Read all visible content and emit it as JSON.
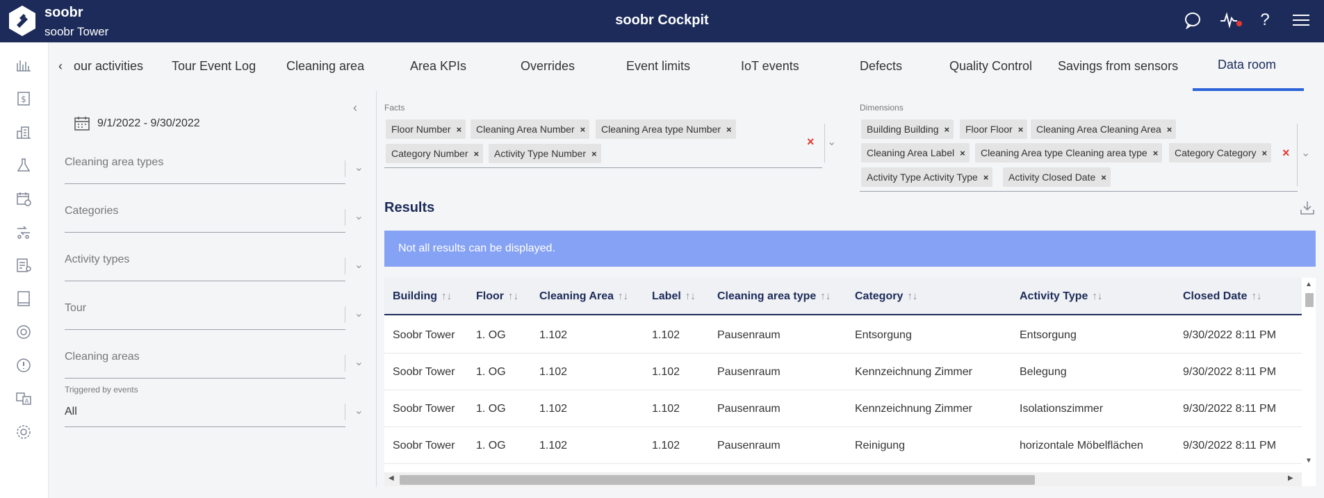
{
  "header": {
    "brand_name": "soobr",
    "building": "soobr Tower",
    "title": "soobr Cockpit"
  },
  "tabs": [
    {
      "label": "our activities"
    },
    {
      "label": "Tour Event Log"
    },
    {
      "label": "Cleaning area"
    },
    {
      "label": "Area KPIs"
    },
    {
      "label": "Overrides"
    },
    {
      "label": "Event limits"
    },
    {
      "label": "IoT events"
    },
    {
      "label": "Defects"
    },
    {
      "label": "Quality Control"
    },
    {
      "label": "Savings from sensors"
    },
    {
      "label": "Data room"
    }
  ],
  "filters": {
    "date_range": "9/1/2022 - 9/30/2022",
    "cleaning_area_types": "Cleaning area types",
    "categories": "Categories",
    "activity_types": "Activity types",
    "tour": "Tour",
    "cleaning_areas": "Cleaning areas",
    "triggered_label": "Triggered by events",
    "triggered_value": "All"
  },
  "facts": {
    "label": "Facts",
    "chips": [
      "Floor Number",
      "Cleaning Area Number",
      "Cleaning Area type Number",
      "Category Number",
      "Activity Type Number"
    ]
  },
  "dimensions": {
    "label": "Dimensions",
    "chips": [
      "Building Building",
      "Floor Floor",
      "Cleaning Area Cleaning Area",
      "Cleaning Area Label",
      "Cleaning Area type Cleaning area type",
      "Category Category",
      "Activity Type Activity Type",
      "Activity Closed Date"
    ]
  },
  "results": {
    "title": "Results",
    "banner": "Not all results can be displayed.",
    "columns": [
      "Building",
      "Floor",
      "Cleaning Area",
      "Label",
      "Cleaning area type",
      "Category",
      "Activity Type",
      "Closed Date"
    ],
    "rows": [
      [
        "Soobr Tower",
        "1. OG",
        "1.102",
        "1.102",
        "Pausenraum",
        "Entsorgung",
        "Entsorgung",
        "9/30/2022 8:11 PM"
      ],
      [
        "Soobr Tower",
        "1. OG",
        "1.102",
        "1.102",
        "Pausenraum",
        "Kennzeichnung Zimmer",
        "Belegung",
        "9/30/2022 8:11 PM"
      ],
      [
        "Soobr Tower",
        "1. OG",
        "1.102",
        "1.102",
        "Pausenraum",
        "Kennzeichnung Zimmer",
        "Isolationszimmer",
        "9/30/2022 8:11 PM"
      ],
      [
        "Soobr Tower",
        "1. OG",
        "1.102",
        "1.102",
        "Pausenraum",
        "Reinigung",
        "horizontale Möbelflächen",
        "9/30/2022 8:11 PM"
      ]
    ]
  },
  "colors": {
    "header_bg": "#1c2b5a",
    "accent": "#2d63d9",
    "banner_bg": "#86a2f5",
    "clear_red": "#e53935"
  }
}
